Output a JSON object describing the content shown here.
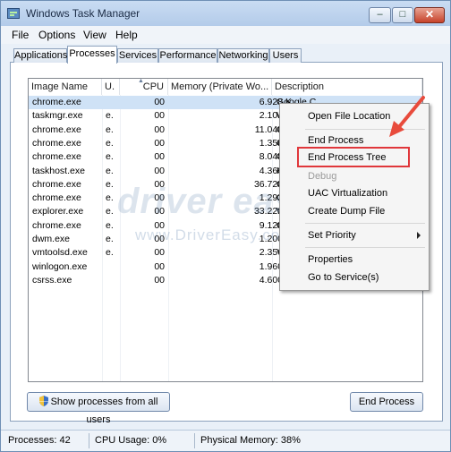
{
  "window": {
    "title": "Windows Task Manager",
    "controls": {
      "minimize": "–",
      "maximize": "□",
      "close": "✕"
    }
  },
  "menu": [
    "File",
    "Options",
    "View",
    "Help"
  ],
  "tabs": [
    "Applications",
    "Processes",
    "Services",
    "Performance",
    "Networking",
    "Users"
  ],
  "active_tab": "Processes",
  "table": {
    "columns": [
      "Image Name",
      "U.",
      "CPU",
      "Memory (Private Wo...",
      "Description"
    ],
    "rows": [
      {
        "name": "chrome.exe",
        "user": "",
        "cpu": "00",
        "memory": "6.928 K",
        "desc": "Google C"
      },
      {
        "name": "taskmgr.exe",
        "user": "e.",
        "cpu": "00",
        "memory": "2.104 K",
        "desc": "W"
      },
      {
        "name": "chrome.exe",
        "user": "e.",
        "cpu": "00",
        "memory": "11.040 K",
        "desc": "G"
      },
      {
        "name": "chrome.exe",
        "user": "e.",
        "cpu": "00",
        "memory": "1.356 K",
        "desc": "C"
      },
      {
        "name": "chrome.exe",
        "user": "e.",
        "cpu": "00",
        "memory": "8.048 K",
        "desc": "C"
      },
      {
        "name": "taskhost.exe",
        "user": "e.",
        "cpu": "00",
        "memory": "4.360 K",
        "desc": "H"
      },
      {
        "name": "chrome.exe",
        "user": "e.",
        "cpu": "00",
        "memory": "36.720 K",
        "desc": "C"
      },
      {
        "name": "chrome.exe",
        "user": "e.",
        "cpu": "00",
        "memory": "1.292 K",
        "desc": "C"
      },
      {
        "name": "explorer.exe",
        "user": "e.",
        "cpu": "00",
        "memory": "33.228 K",
        "desc": "W"
      },
      {
        "name": "chrome.exe",
        "user": "e.",
        "cpu": "00",
        "memory": "9.120 K",
        "desc": "C"
      },
      {
        "name": "dwm.exe",
        "user": "e.",
        "cpu": "00",
        "memory": "1.200 K",
        "desc": ""
      },
      {
        "name": "vmtoolsd.exe",
        "user": "e.",
        "cpu": "00",
        "memory": "2.356 K",
        "desc": "V"
      },
      {
        "name": "winlogon.exe",
        "user": "",
        "cpu": "00",
        "memory": "1.960 K",
        "desc": ""
      },
      {
        "name": "csrss.exe",
        "user": "",
        "cpu": "00",
        "memory": "4.600 K",
        "desc": ""
      }
    ]
  },
  "watermark": {
    "logo": "driver easy",
    "url": "www.DriverEasy.com"
  },
  "buttons": {
    "show_all": "Show processes from all users",
    "end_process": "End Process"
  },
  "status": {
    "processes": "Processes: 42",
    "cpu": "CPU Usage: 0%",
    "memory": "Physical Memory: 38%"
  },
  "context_menu": {
    "items": [
      "Open File Location",
      "End Process",
      "End Process Tree",
      "Debug",
      "UAC Virtualization",
      "Create Dump File",
      "Set Priority",
      "Properties",
      "Go to Service(s)"
    ],
    "disabled": [
      "Debug"
    ],
    "highlighted": "End Process Tree"
  },
  "colors": {
    "highlight": "#e0373b",
    "arrow": "#e84b3c",
    "selection": "#cfe2f6",
    "window_border": "#6f8fb5"
  }
}
